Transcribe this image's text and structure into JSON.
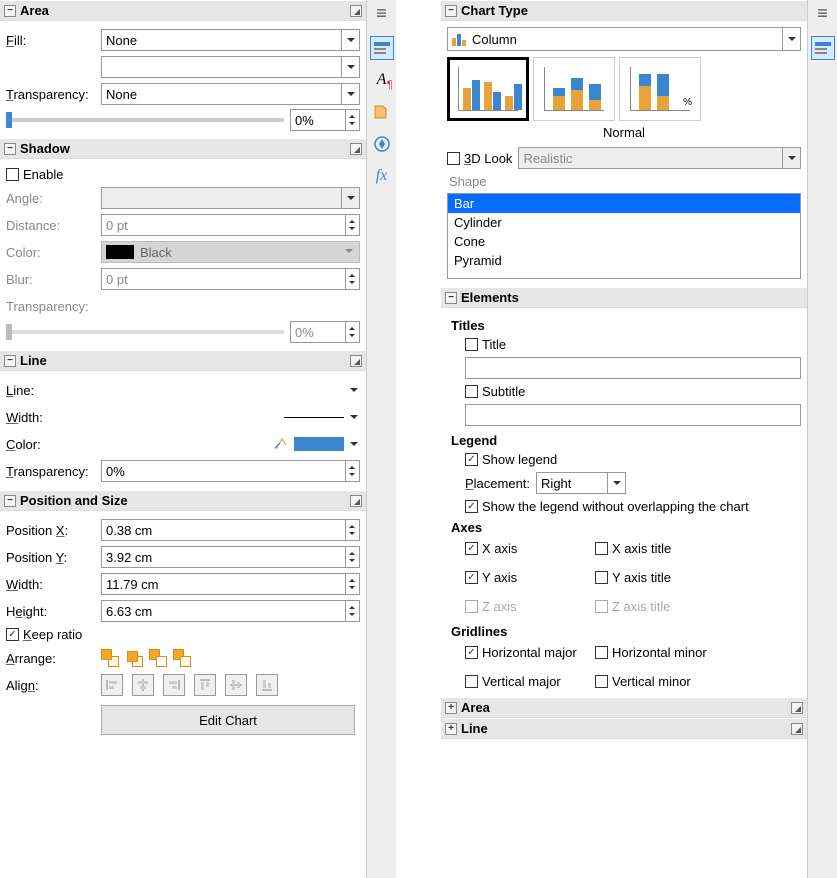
{
  "left": {
    "area": {
      "title": "Area",
      "fill_label": "Fill:",
      "fill_value": "None",
      "trans_label": "Transparency:",
      "trans_value": "None",
      "trans_pct": "0%"
    },
    "shadow": {
      "title": "Shadow",
      "enable": "Enable",
      "angle": "Angle:",
      "distance": "Distance:",
      "distance_val": "0 pt",
      "color": "Color:",
      "color_val": "Black",
      "blur": "Blur:",
      "blur_val": "0 pt",
      "trans": "Transparency:",
      "trans_pct": "0%"
    },
    "line": {
      "title": "Line",
      "line": "Line:",
      "width": "Width:",
      "color": "Color:",
      "trans": "Transparency:",
      "trans_val": "0%"
    },
    "pos": {
      "title": "Position and Size",
      "px": "Position X:",
      "px_val": "0.38 cm",
      "py": "Position Y:",
      "py_val": "3.92 cm",
      "w": "Width:",
      "w_val": "11.79 cm",
      "h": "Height:",
      "h_val": "6.63 cm",
      "keep": "Keep ratio",
      "arrange": "Arrange:",
      "align": "Align:",
      "edit": "Edit Chart"
    }
  },
  "right": {
    "chartType": {
      "title": "Chart Type",
      "combo": "Column",
      "subtype_label": "Normal",
      "look3d": "3D Look",
      "look3d_val": "Realistic",
      "shape_label": "Shape",
      "shapes": [
        "Bar",
        "Cylinder",
        "Cone",
        "Pyramid"
      ]
    },
    "elements": {
      "title": "Elements",
      "titles_h": "Titles",
      "title_cb": "Title",
      "subtitle_cb": "Subtitle",
      "legend_h": "Legend",
      "show_legend": "Show legend",
      "placement": "Placement:",
      "placement_val": "Right",
      "no_overlap": "Show the legend without overlapping the chart",
      "axes_h": "Axes",
      "x_axis": "X axis",
      "x_title": "X axis title",
      "y_axis": "Y axis",
      "y_title": "Y axis title",
      "z_axis": "Z axis",
      "z_title": "Z axis title",
      "gridlines_h": "Gridlines",
      "h_major": "Horizontal major",
      "h_minor": "Horizontal minor",
      "v_major": "Vertical major",
      "v_minor": "Vertical minor"
    },
    "area_collapsed": "Area",
    "line_collapsed": "Line"
  }
}
